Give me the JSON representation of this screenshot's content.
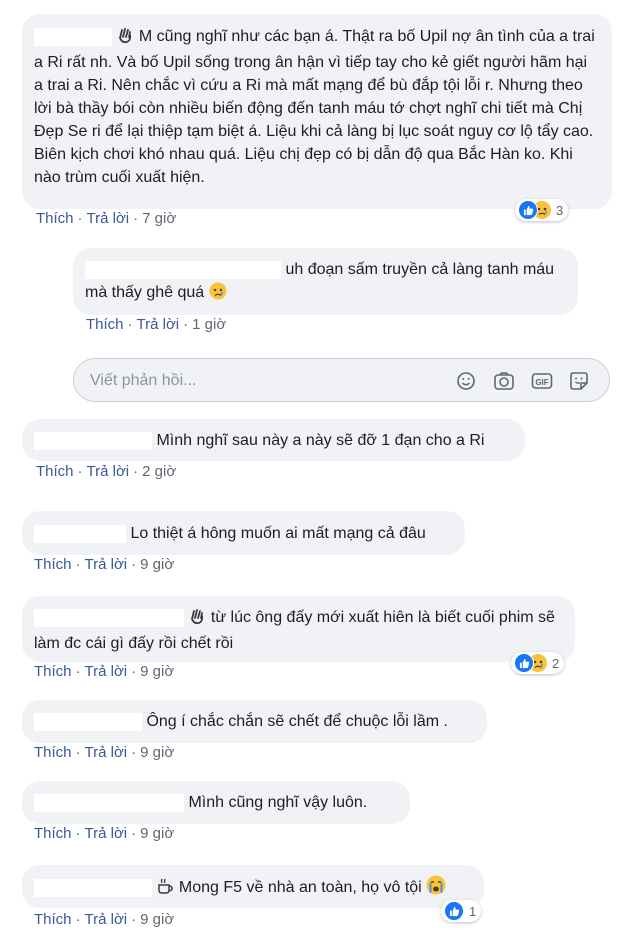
{
  "actions": {
    "like": "Thích",
    "reply": "Trả lời",
    "sep": "·"
  },
  "reply_box": {
    "placeholder": "Viết phản hồi..."
  },
  "comments": [
    {
      "text": "M cũng nghĩ như các bạn á. Thật ra bố Upil nợ ân tình của a trai a Ri rất nh. Và bố Upil sống trong ân hận vì tiếp tay cho kẻ giết người hãm hại a trai a Ri. Nên chắc vì cứu a Ri mà mất mạng để bù đắp tội lỗi r. Nhưng theo lời bà thầy bói còn nhiều biến động đến tanh máu tớ chợt nghĩ chi tiết mà Chị Đẹp Se ri để lại thiệp tạm biệt á. Liệu khi cả làng bị lục soát nguy cơ lộ tẩy cao. Biên kịch chơi khó nhau quá. Liệu chị đẹp có bị dẫn độ qua Bắc Hàn ko. Khi nào trùm cuối xuất hiện.",
      "time": "7 giờ",
      "reactions": "3"
    },
    {
      "text": "uh đoạn sấm truyền cả làng tanh máu mà thấy ghê quá",
      "time": "1 giờ"
    },
    {
      "text": "Mình nghĩ sau này a này sẽ đỡ 1 đạn cho a Ri",
      "time": "2 giờ"
    },
    {
      "text": "Lo thiệt á hông muốn ai mất mạng cả đâu",
      "time": "9 giờ"
    },
    {
      "text": "từ lúc ông đấy mới xuất hiên là biết cuối phim sẽ làm đc cái gì đấy rồi chết rồi",
      "time": "9 giờ",
      "reactions": "2"
    },
    {
      "text": "Ông í chắc chắn sẽ chết để chuộc lỗi lầm .",
      "time": "9 giờ"
    },
    {
      "text": "Mình cũng nghĩ vậy luôn.",
      "time": "9 giờ"
    },
    {
      "text": "Mong F5 về nhà an toàn, họ vô tội",
      "time": "9 giờ",
      "reactions": "1"
    }
  ]
}
